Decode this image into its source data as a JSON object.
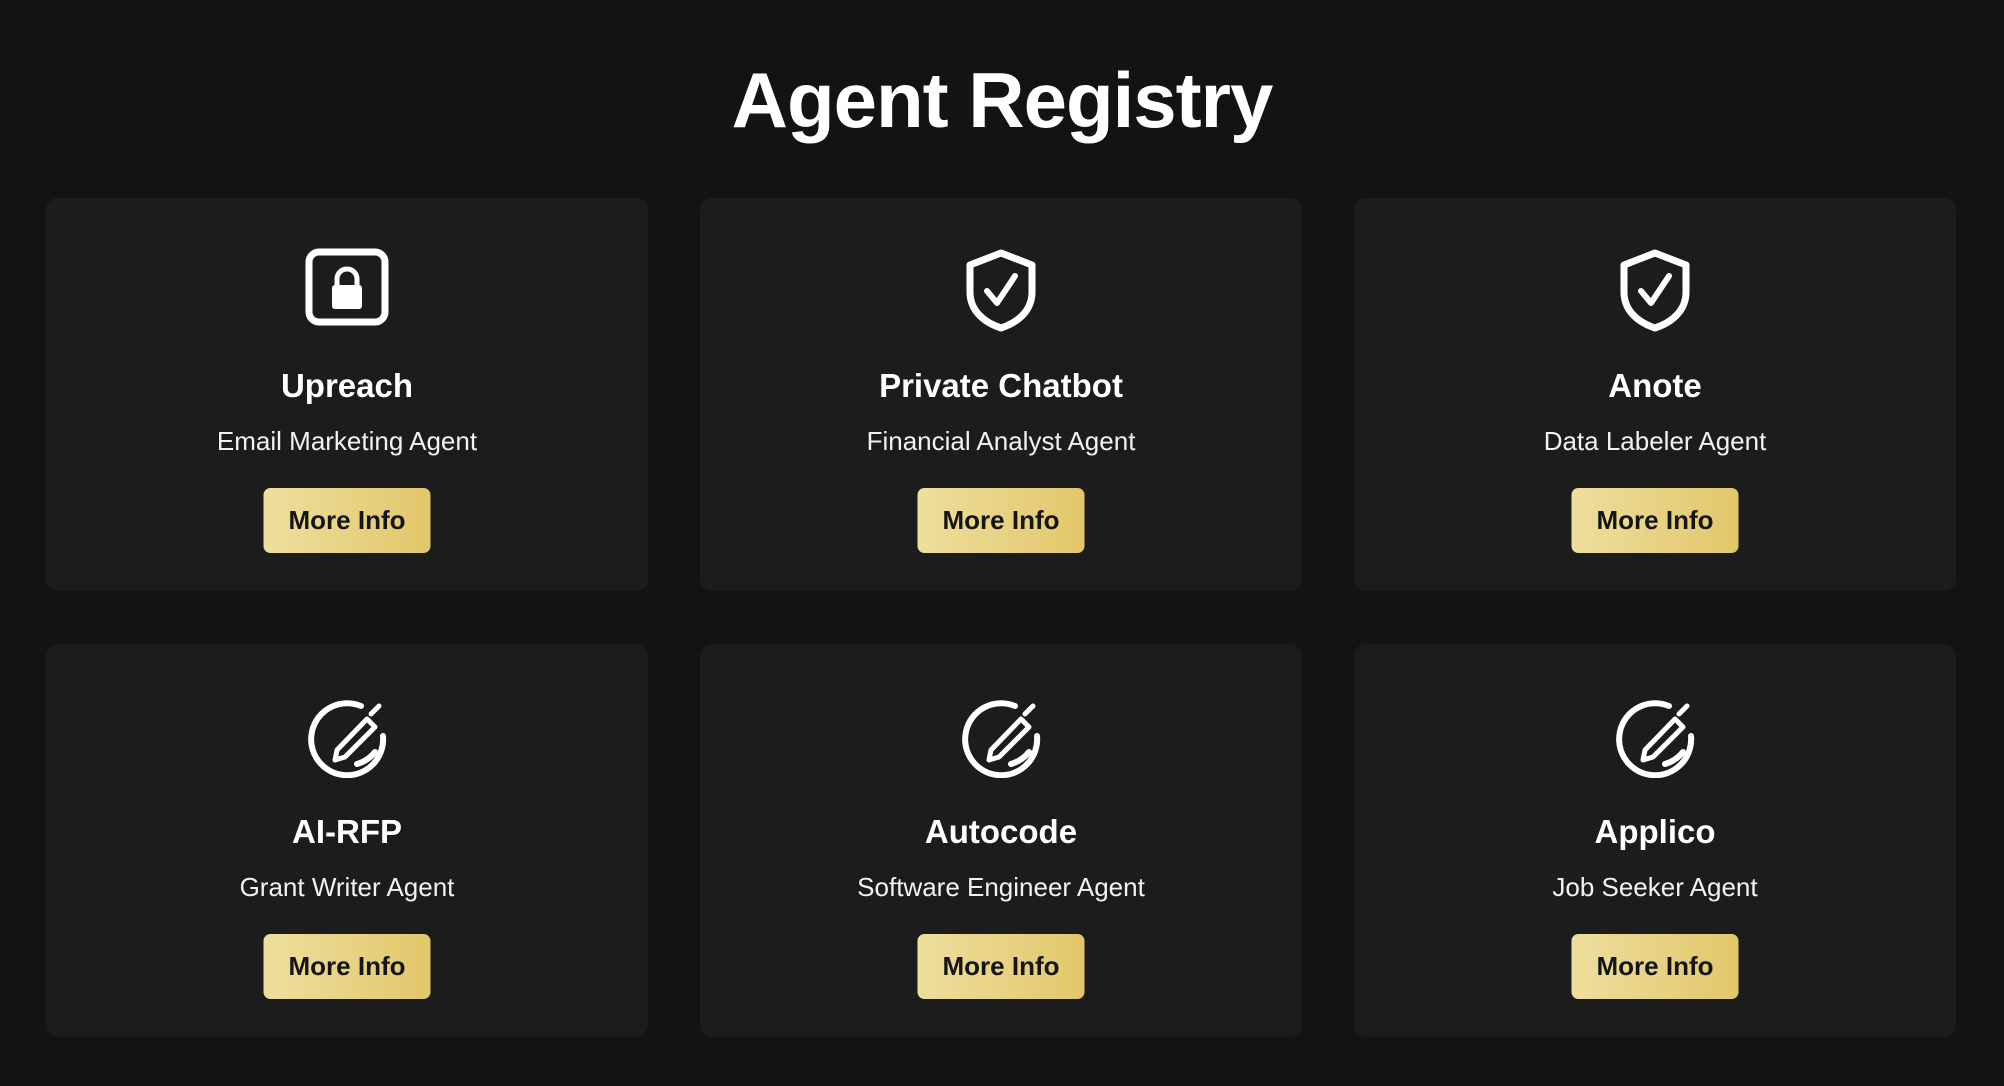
{
  "header": {
    "title": "Agent Registry"
  },
  "agents": [
    {
      "name": "Upreach",
      "role": "Email Marketing Agent",
      "icon": "lock-icon",
      "button_label": "More Info"
    },
    {
      "name": "Private Chatbot",
      "role": "Financial Analyst Agent",
      "icon": "shield-check-icon",
      "button_label": "More Info"
    },
    {
      "name": "Anote",
      "role": "Data Labeler Agent",
      "icon": "shield-check-icon",
      "button_label": "More Info"
    },
    {
      "name": "AI-RFP",
      "role": "Grant Writer Agent",
      "icon": "edit-circle-icon",
      "button_label": "More Info"
    },
    {
      "name": "Autocode",
      "role": "Software Engineer Agent",
      "icon": "edit-circle-icon",
      "button_label": "More Info"
    },
    {
      "name": "Applico",
      "role": "Job Seeker Agent",
      "icon": "edit-circle-icon",
      "button_label": "More Info"
    }
  ],
  "colors": {
    "background": "#131313",
    "card": "#1c1c1c",
    "button_gradient_start": "#eedf9e",
    "button_gradient_end": "#e2c66a",
    "text": "#ffffff"
  }
}
